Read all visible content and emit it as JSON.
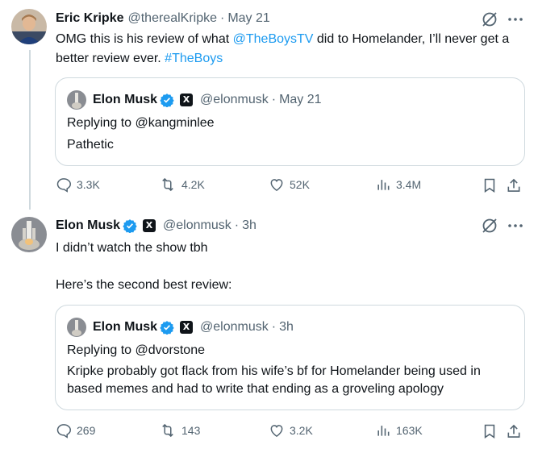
{
  "tweet1": {
    "name": "Eric Kripke",
    "handle": "@therealKripke",
    "sep": "·",
    "date": "May 21",
    "text_before": "OMG this is his review of what ",
    "mention": "@TheBoysTV",
    "text_middle": " did to Homelander, I’ll never get a better review ever. ",
    "hashtag": "#TheBoys",
    "quote": {
      "name": "Elon Musk",
      "handle": "@elonmusk",
      "sep": "·",
      "date": "May 21",
      "replying": "Replying to @kangminlee",
      "text": "Pathetic"
    },
    "actions": {
      "replies": "3.3K",
      "reposts": "4.2K",
      "likes": "52K",
      "views": "3.4M"
    }
  },
  "tweet2": {
    "name": "Elon Musk",
    "handle": "@elonmusk",
    "sep": "·",
    "date": "3h",
    "text_line1": "I didn’t watch the show tbh",
    "text_line2": "Here’s the second best review:",
    "quote": {
      "name": "Elon Musk",
      "handle": "@elonmusk",
      "sep": "·",
      "date": "3h",
      "replying": "Replying to @dvorstone",
      "text": "Kripke probably got flack from his wife’s bf for Homelander being used in based memes and had to write that ending as a groveling apology"
    },
    "actions": {
      "replies": "269",
      "reposts": "143",
      "likes": "3.2K",
      "views": "163K"
    }
  },
  "badges": {
    "x_badge": "X"
  },
  "colors": {
    "link": "#1d9bf0",
    "muted": "#536471",
    "verified": "#1d9bf0",
    "border": "#cfd9de"
  }
}
